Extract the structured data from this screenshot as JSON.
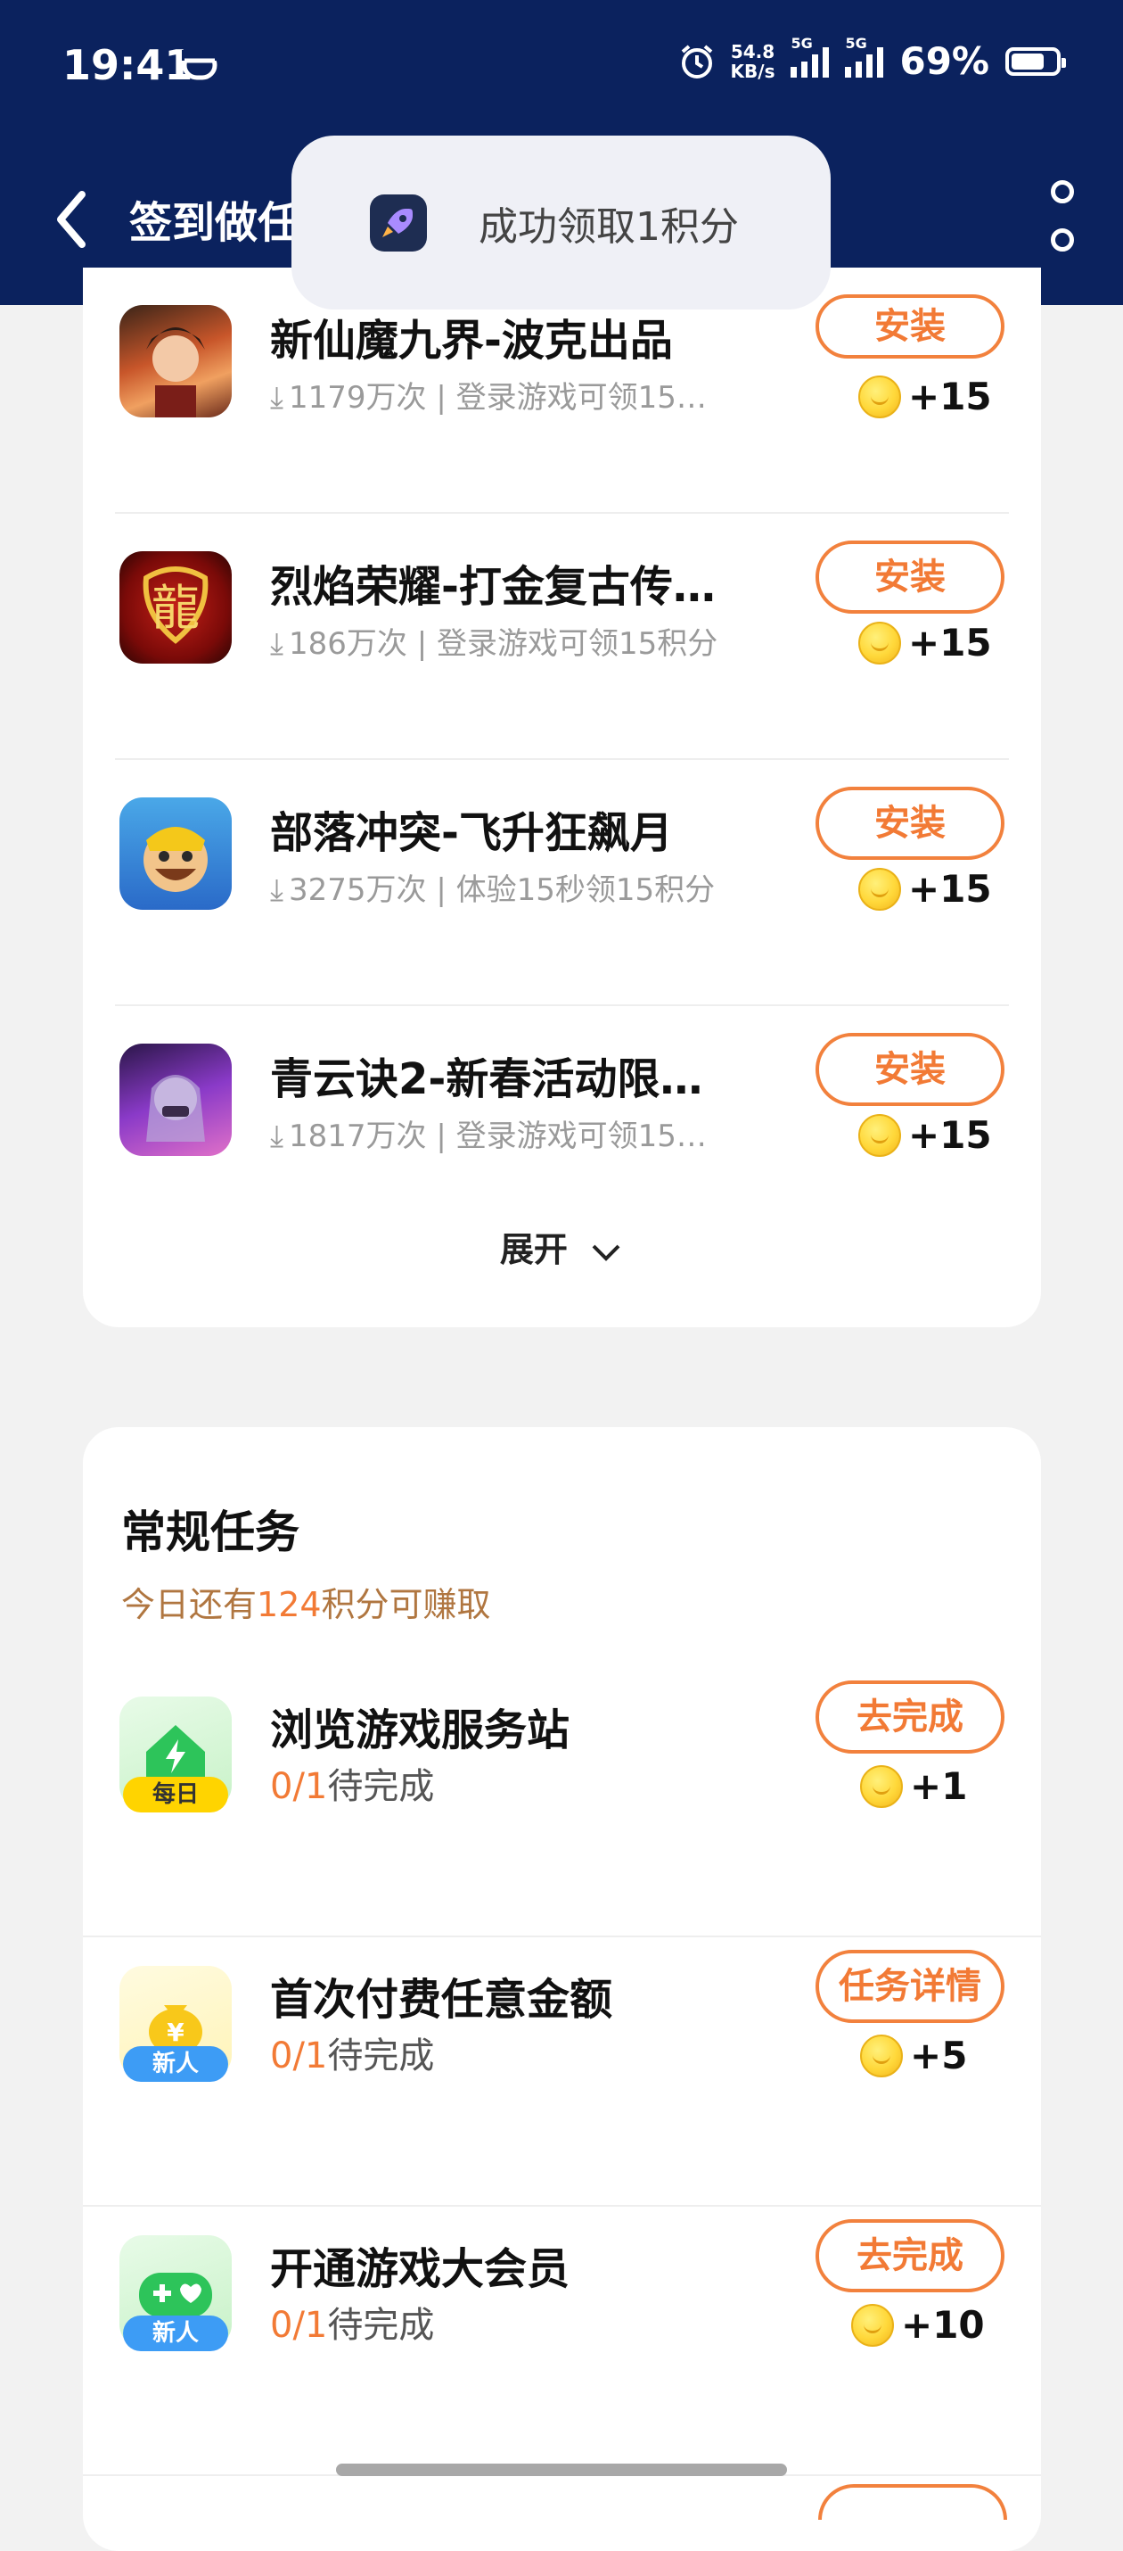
{
  "status_bar": {
    "time": "19:41",
    "net_speed_value": "54.8",
    "net_speed_unit": "KB/s",
    "signal1_label": "5G",
    "signal2_label": "5G",
    "battery": "69%"
  },
  "header": {
    "title": "签到做任务",
    "back_icon": "chevron-left-icon",
    "more_icon": "more-vertical-icon"
  },
  "toast": {
    "text": "成功领取1积分",
    "icon": "rocket-icon"
  },
  "games": [
    {
      "name": "新仙魔九界-波克出品",
      "downloads": "1179万次",
      "desc": "登录游戏可领15…",
      "button": "安装",
      "reward": "+15"
    },
    {
      "name": "烈焰荣耀-打金复古传…",
      "downloads": "186万次",
      "desc": "登录游戏可领15积分",
      "button": "安装",
      "reward": "+15"
    },
    {
      "name": "部落冲突-飞升狂飙月",
      "downloads": "3275万次",
      "desc": "体验15秒领15积分",
      "button": "安装",
      "reward": "+15"
    },
    {
      "name": "青云诀2-新春活动限…",
      "downloads": "1817万次",
      "desc": "登录游戏可领15…",
      "button": "安装",
      "reward": "+15"
    }
  ],
  "expand_label": "展开",
  "regular": {
    "title": "常规任务",
    "sub_prefix": "今日还有",
    "sub_num": "124",
    "sub_suffix": "积分可赚取",
    "tasks": [
      {
        "badge": "每日",
        "name": "浏览游戏服务站",
        "progress": "0/1",
        "status": "待完成",
        "button": "去完成",
        "reward": "+1",
        "icon": "home-lightning-icon"
      },
      {
        "badge": "新人",
        "name": "首次付费任意金额",
        "progress": "0/1",
        "status": "待完成",
        "button": "任务详情",
        "reward": "+5",
        "icon": "money-bag-icon"
      },
      {
        "badge": "新人",
        "name": "开通游戏大会员",
        "progress": "0/1",
        "status": "待完成",
        "button": "去完成",
        "reward": "+10",
        "icon": "gamepad-icon"
      }
    ]
  },
  "colors": {
    "header_bg": "#0b225e",
    "accent_orange": "#f27a35",
    "sub_brown": "#b07640",
    "badge_daily": "#ffd400",
    "badge_new": "#3d9cf5"
  }
}
